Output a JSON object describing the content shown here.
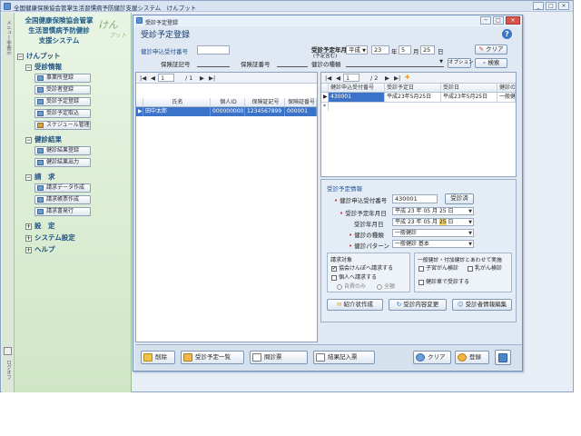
{
  "outer_window": {
    "title": "全国健康保険協会管掌生活習慣病予防健診支援システム　けんプット",
    "controls": [
      "_",
      "□",
      "×"
    ]
  },
  "side_strip": {
    "top_label": "メニュー非表示",
    "bottom_label": "ログオフ"
  },
  "sidebar": {
    "brand": {
      "line1": "全国健康保険協会管掌",
      "line2": "生活習慣病予防健診",
      "line3": "支援システム",
      "logo_main": "けん",
      "logo_sub": "プット"
    },
    "root": "けんプット",
    "sections": [
      {
        "label": "受診情報",
        "items": [
          "事業所登録",
          "受診者登録",
          "受診予定登録",
          "受診予定取込",
          "スケジュール管理"
        ]
      },
      {
        "label": "健診結果",
        "items": [
          "健診結果登録",
          "健診結果出力"
        ]
      },
      {
        "label": "請　求",
        "items": [
          "請求データ作成",
          "請求帳票作成",
          "請求書発行"
        ]
      }
    ],
    "collapsed": [
      "設　定",
      "システム設定",
      "ヘルプ"
    ]
  },
  "inner_window": {
    "title": "受診予定登録",
    "controls": [
      "─",
      "□",
      "×"
    ]
  },
  "form": {
    "title": "受診予定登録",
    "labels": {
      "application_no": "健診申込受付番号",
      "insurer_code": "保険証記号",
      "insurer_no": "保険証番号",
      "scheduled_date": "受診予定年月日",
      "scheduled_date_sub": "(予定含む)",
      "exam_type": "健診の種類"
    },
    "date": {
      "era": "平成",
      "year": "23",
      "year_unit": "年",
      "month": "5",
      "month_unit": "月",
      "day": "25",
      "day_unit": "日"
    },
    "buttons": {
      "clear": "クリア",
      "option": "オプション",
      "search": "検索"
    }
  },
  "left_grid": {
    "nav": {
      "current": "1",
      "total": "/ 1"
    },
    "columns": [
      "氏名",
      "個人ID",
      "保険証記号",
      "保険証番号"
    ],
    "rows": [
      {
        "name": "田中太郎",
        "id": "0000000001",
        "code": "1234567899",
        "number": "000001"
      }
    ]
  },
  "right_grid": {
    "nav": {
      "current": "1",
      "total": "/ 2"
    },
    "columns": [
      "健診申込受付番号",
      "受診予定日",
      "受診日",
      "健診の種"
    ],
    "rows": [
      {
        "app_no": "430001",
        "plan": "平成23年5月25日",
        "date": "平成23年5月25日",
        "kind": "一般健診"
      }
    ]
  },
  "detail": {
    "title": "受診予定情報",
    "application_no_label": "健診申込受付番号",
    "application_no": "430001",
    "registered_btn": "受診済",
    "scheduled_label": "受診予定年月日",
    "scheduled": {
      "era": "平成",
      "year": "23",
      "year_unit": "年",
      "month": "05",
      "month_unit": "月",
      "day": "25",
      "day_unit": "日"
    },
    "exam_date_label": "受診年月日",
    "exam_date": {
      "era": "平成",
      "year": "23",
      "year_unit": "年",
      "month": "05",
      "month_unit": "月",
      "day": "25",
      "day_unit": "日"
    },
    "kind_label": "健診の種類",
    "kind": "一般健診",
    "pattern_label": "健診パターン",
    "pattern": "一般健診 基本",
    "billing": {
      "title": "請求対象",
      "opt1": "協会けんぽへ請求する",
      "opt2": "個人へ請求する",
      "radio1": "自費のみ",
      "radio2": "全額"
    },
    "additional": {
      "title": "一般健診・付加健診とあわせて実施",
      "opt1": "子宮がん検診",
      "opt2": "乳がん検診",
      "opt3": "健診車で受診する"
    },
    "buttons": {
      "referral": "紹介状作成",
      "change": "受診内容変更",
      "edit_patient": "受診者情報編集"
    }
  },
  "bottom_bar": {
    "delete": "削除",
    "schedule_list": "受診予定一覧",
    "questionnaire": "問診票",
    "result_entry": "結果記入票",
    "clear": "クリア",
    "register": "登録"
  }
}
